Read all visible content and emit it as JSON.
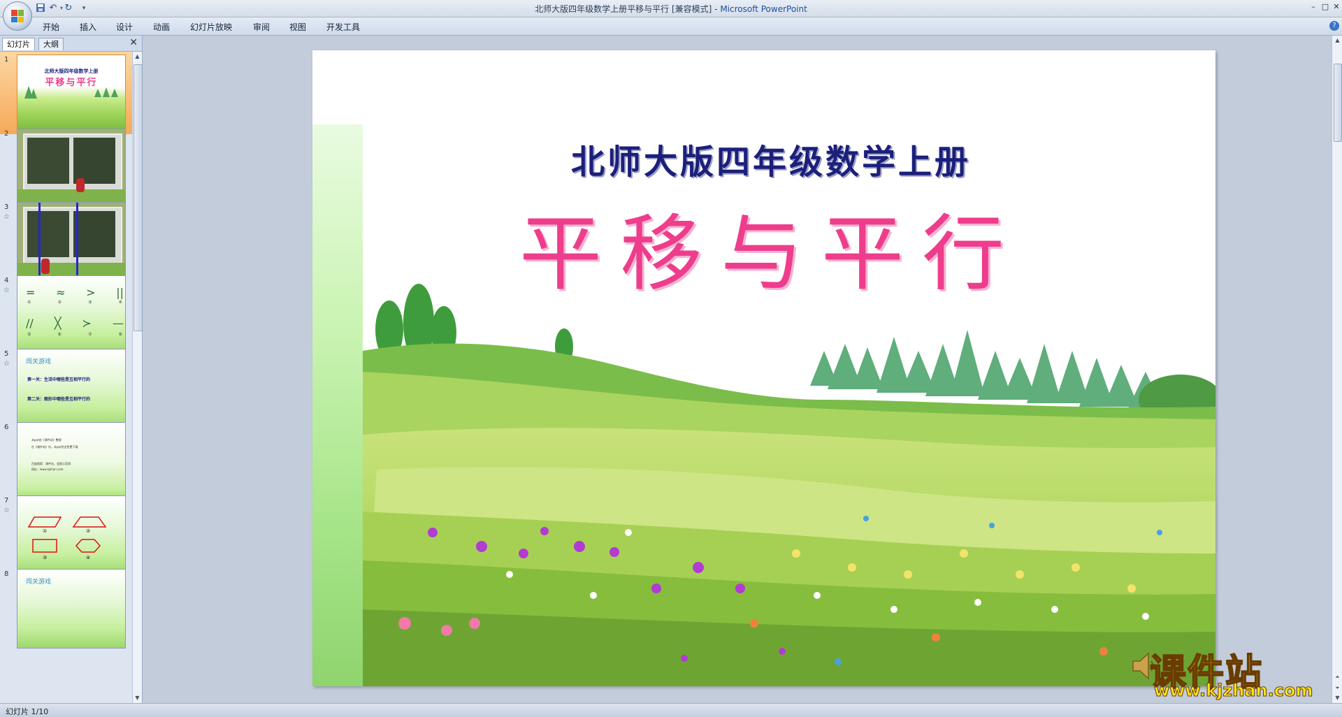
{
  "window": {
    "title": "北师大版四年级数学上册平移与平行 [兼容模式]",
    "app_name": " - Microsoft PowerPoint",
    "minimize": "–",
    "maximize": "□",
    "close": "✕"
  },
  "ribbon": {
    "tabs": [
      "开始",
      "插入",
      "设计",
      "动画",
      "幻灯片放映",
      "审阅",
      "视图",
      "开发工具"
    ],
    "help": "?"
  },
  "panel": {
    "tabs": [
      "幻灯片",
      "大纲"
    ],
    "close": "✕",
    "slides": [
      {
        "num": "1",
        "anim": "",
        "title": "北师大版四年级数学上册",
        "heading": "平移与平行"
      },
      {
        "num": "2",
        "anim": ""
      },
      {
        "num": "3",
        "anim": "☆"
      },
      {
        "num": "4",
        "anim": "☆",
        "symbols": [
          "=",
          "≈",
          ">",
          "||",
          "//",
          "╳",
          "≻",
          "—"
        ],
        "circles": [
          "①",
          "②",
          "③",
          "④",
          "⑤",
          "⑥",
          "⑦",
          "⑧"
        ]
      },
      {
        "num": "5",
        "anim": "☆",
        "heading": "闯关游戏",
        "lines": [
          "第一关：生活中哪些是互相平行的",
          "第二关：图形中哪些是互相平行的"
        ]
      },
      {
        "num": "6",
        "anim": "",
        "lines": [
          "本ppt由《课件站》整理",
          "在《课件站》内，本ppt完全免费下载",
          "百度搜索：课件站，会提示官网",
          "网址：www.kjzhan.com"
        ]
      },
      {
        "num": "7",
        "anim": "☆",
        "labels": [
          "①",
          "②",
          "③",
          "④"
        ]
      },
      {
        "num": "8",
        "anim": "",
        "heading": "闯关游戏"
      }
    ]
  },
  "slide": {
    "subtitle": "北师大版四年级数学上册",
    "title": "平移与平行",
    "speaker_icon": "speaker-icon"
  },
  "watermark": {
    "text": "课件站",
    "url": "www.kjzhan.com"
  },
  "status": {
    "text": "幻灯片 1/10"
  },
  "colors": {
    "title_pink": "#ee3d8c",
    "subtitle_navy": "#1c1f7a",
    "selected_thumb": "#f6a95a"
  }
}
